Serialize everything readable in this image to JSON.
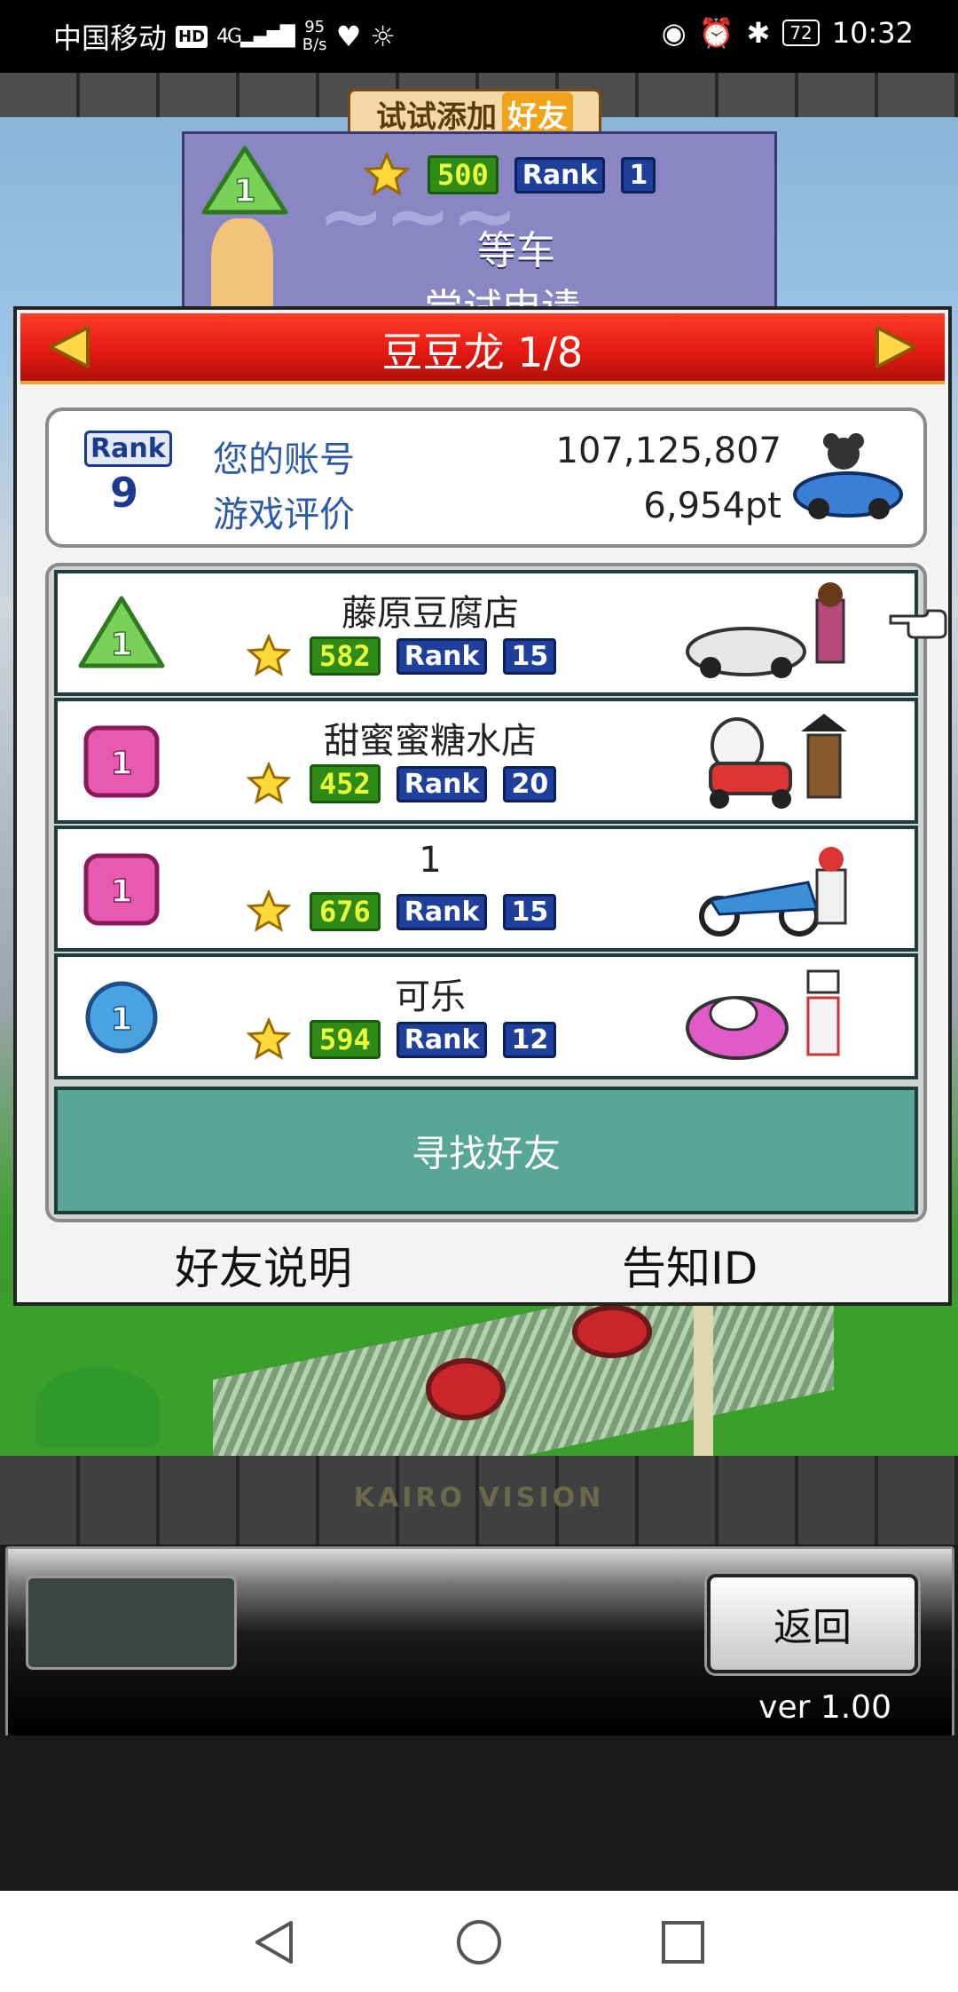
{
  "status_bar": {
    "carrier": "中国移动",
    "hd": "HD",
    "signal_type": "4G",
    "speed_value": "95",
    "speed_unit": "B/s",
    "battery": "72",
    "time": "10:32"
  },
  "promo": {
    "try_add_prefix": "试试添加",
    "try_add_highlight": "好友",
    "rank_badge_value": "1",
    "stars": "500",
    "rank_label": "Rank",
    "rank_value": "1",
    "waiting_text": "等车",
    "apply_text": "尝试申请"
  },
  "panel": {
    "header_title": "豆豆龙 1/8",
    "account": {
      "rank_label": "Rank",
      "rank_value": "9",
      "account_label": "您的账号",
      "account_value": "107,125,807",
      "rating_label": "游戏评价",
      "rating_value": "6,954pt"
    },
    "friends": [
      {
        "name": "藤原豆腐店",
        "badge_value": "1",
        "badge_color": "#7ad15a",
        "badge_shape": "triangle",
        "stars": "582",
        "rank_label": "Rank",
        "rank": "15"
      },
      {
        "name": "甜蜜蜜糖水店",
        "badge_value": "1",
        "badge_color": "#e65bb0",
        "badge_shape": "square",
        "stars": "452",
        "rank_label": "Rank",
        "rank": "20"
      },
      {
        "name": "1",
        "badge_value": "1",
        "badge_color": "#e65bb0",
        "badge_shape": "square",
        "stars": "676",
        "rank_label": "Rank",
        "rank": "15"
      },
      {
        "name": "可乐",
        "badge_value": "1",
        "badge_color": "#4aa3e0",
        "badge_shape": "circle",
        "stars": "594",
        "rank_label": "Rank",
        "rank": "12"
      }
    ],
    "find_friend_label": "寻找好友",
    "friend_help_label": "好友说明",
    "notify_id_label": "告知ID"
  },
  "footer": {
    "brand": "KAIRO VISION",
    "back_label": "返回",
    "version": "ver 1.00"
  },
  "icons": {
    "prev": "triangle-left-icon",
    "next": "triangle-right-icon",
    "star": "star-icon",
    "nav_back": "nav-back-icon",
    "nav_home": "nav-home-icon",
    "nav_recents": "nav-recents-icon"
  }
}
